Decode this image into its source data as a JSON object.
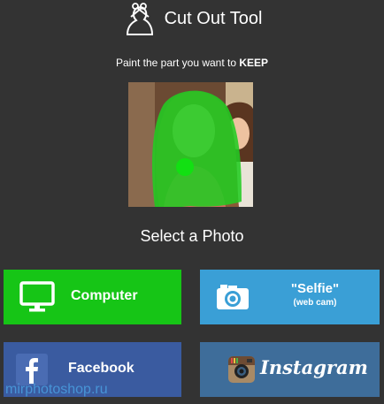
{
  "header": {
    "title": "Cut Out Tool",
    "logo_icon": "scissors-head-icon"
  },
  "instruction": {
    "text": "Paint the part you want to ",
    "emphasis": "KEEP"
  },
  "preview": {
    "paint_color": "#22cc22"
  },
  "select_title": "Select a Photo",
  "buttons": {
    "computer": {
      "label": "Computer",
      "icon": "monitor-icon",
      "color": "#16c516"
    },
    "selfie": {
      "label": "\"Selfie\"",
      "sublabel": "(web cam)",
      "icon": "camera-icon",
      "color": "#3a9fd6"
    },
    "facebook": {
      "label": "Facebook",
      "icon": "facebook-icon",
      "color": "#3a5ba0"
    },
    "instagram": {
      "label": "Instagram",
      "icon": "instagram-icon",
      "color": "#3e6d9a"
    }
  },
  "watermark": "mirphotoshop.ru"
}
